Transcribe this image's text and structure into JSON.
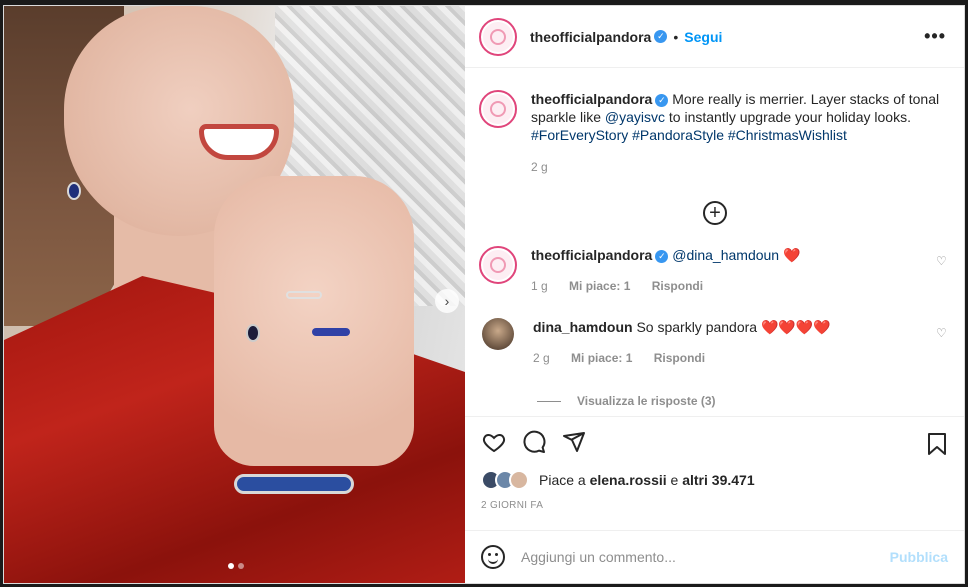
{
  "post": {
    "username": "theofficialpandora",
    "follow_label": "Segui",
    "separator": "•",
    "more_icon": "more-options-icon",
    "verified_glyph": "✓"
  },
  "caption": {
    "username": "theofficialpandora",
    "text_1": "More really is merrier. Layer stacks of tonal sparkle like ",
    "mention": "@yayisvc",
    "text_2": " to instantly upgrade your holiday looks.",
    "hashtags": "#ForEveryStory #PandoraStyle #ChristmasWishlist",
    "time": "2 g"
  },
  "load_more_icon": "plus-circle-icon",
  "comments": [
    {
      "username": "theofficialpandora",
      "mention": "@dina_hamdoun",
      "emoji": "❤️",
      "time": "1 g",
      "likes": "Mi piace: 1",
      "reply": "Rispondi"
    },
    {
      "username": "dina_hamdoun",
      "text": "So sparkly pandora",
      "emoji": "❤️❤️❤️❤️",
      "time": "2 g",
      "likes": "Mi piace: 1",
      "reply": "Rispondi"
    }
  ],
  "view_replies": "Visualizza le risposte (3)",
  "actions": {
    "likes_prefix": "Piace a ",
    "liked_by": "elena.rossii",
    "likes_mid": " e ",
    "likes_count": "altri 39.471",
    "posted": "2 GIORNI FA"
  },
  "add_comment": {
    "placeholder": "Aggiungi un commento...",
    "publish": "Pubblica"
  },
  "colors": {
    "accent": "#0095f6",
    "link": "#00376b",
    "muted": "#8e8e8e",
    "heart": "#e0245e"
  }
}
